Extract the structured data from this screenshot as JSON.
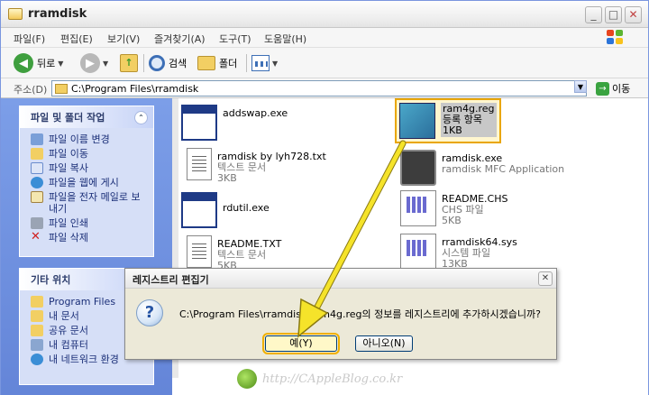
{
  "window": {
    "title": "rramdisk",
    "min_glyph": "_",
    "max_glyph": "□",
    "close_glyph": "✕"
  },
  "menu": [
    "파일(F)",
    "편집(E)",
    "보기(V)",
    "즐겨찾기(A)",
    "도구(T)",
    "도움말(H)"
  ],
  "toolbar": {
    "back": "뒤로",
    "search": "검색",
    "folders": "폴더"
  },
  "address": {
    "label": "주소(D)",
    "path": "C:\\Program Files\\rramdisk",
    "go": "이동"
  },
  "tasks_panel": {
    "title": "파일 및 폴더 작업",
    "items": [
      "파일 이름 변경",
      "파일 이동",
      "파일 복사",
      "파일을 웹에 게시",
      "파일을 전자 메일로 보내기",
      "파일 인쇄",
      "파일 삭제"
    ]
  },
  "places_panel": {
    "title": "기타 위치",
    "items": [
      "Program Files",
      "내 문서",
      "공유 문서",
      "내 컴퓨터",
      "내 네트워크 환경"
    ]
  },
  "files": [
    {
      "name": "addswap.exe",
      "line2": "",
      "line3": ""
    },
    {
      "name": "ramdisk by lyh728.txt",
      "line2": "텍스트 문서",
      "line3": "3KB"
    },
    {
      "name": "rdutil.exe",
      "line2": "",
      "line3": ""
    },
    {
      "name": "README.TXT",
      "line2": "텍스트 문서",
      "line3": "5KB"
    },
    {
      "name": "ram4g.reg",
      "line2": "등록 항목",
      "line3": "1KB"
    },
    {
      "name": "ramdisk.exe",
      "line2": "ramdisk MFC Application",
      "line3": ""
    },
    {
      "name": "README.CHS",
      "line2": "CHS 파일",
      "line3": "5KB"
    },
    {
      "name": "rramdisk64.sys",
      "line2": "시스템 파일",
      "line3": "13KB"
    }
  ],
  "dialog": {
    "title": "레지스트리 편집기",
    "message": "C:\\Program Files\\rramdisk\\ram4g.reg의 정보를 레지스트리에 추가하시겠습니까?",
    "yes": "예(Y)",
    "no": "아니오(N)",
    "close_glyph": "✕",
    "question_glyph": "?"
  },
  "watermark": "http://CAppleBlog.co.kr",
  "colors": {
    "highlight": "#f0b000",
    "arrow": "#f5e32a",
    "task_text": "#1b2f78"
  }
}
